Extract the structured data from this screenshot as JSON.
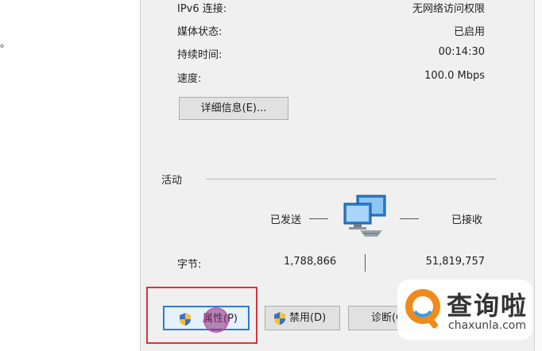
{
  "background_window": {
    "fragment": "。"
  },
  "dialog": {
    "rows": [
      {
        "label": "IPv6 连接:",
        "value": "无网络访问权限"
      },
      {
        "label": "媒体状态:",
        "value": "已启用"
      },
      {
        "label": "持续时间:",
        "value": "00:14:30"
      },
      {
        "label": "速度:",
        "value": "100.0 Mbps"
      }
    ],
    "details_button": "详细信息(E)...",
    "activity": {
      "title": "活动",
      "sent_label": "已发送",
      "received_label": "已接收",
      "bytes_label": "字节:",
      "bytes_sent": "1,788,866",
      "bytes_received": "51,819,757"
    },
    "buttons": {
      "properties": "属性(P)",
      "disable": "禁用(D)",
      "diagnose": "诊断(G)"
    }
  },
  "watermark": {
    "brand": "查询啦",
    "url": "chaxunla.com"
  },
  "colors": {
    "highlight": "#d9343a",
    "focus": "#2e7bd1",
    "dialog_bg": "#f0f0f0"
  }
}
